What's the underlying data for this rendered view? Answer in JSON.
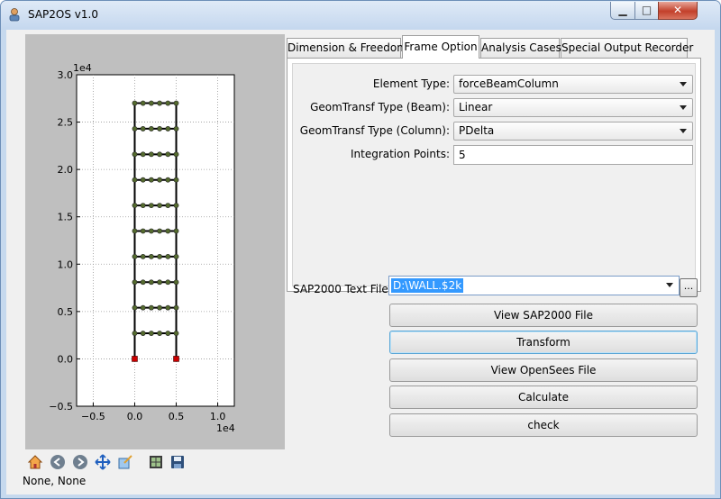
{
  "window": {
    "title": "SAP2OS v1.0",
    "min_glyph": "▁",
    "max_glyph": "□",
    "close_glyph": "✕"
  },
  "tabs": [
    {
      "label": "Dimension & Freedom",
      "active": false
    },
    {
      "label": "Frame Option",
      "active": true
    },
    {
      "label": "Analysis Cases",
      "active": false
    },
    {
      "label": "Special Output Recorder",
      "active": false
    }
  ],
  "frame_option": {
    "element_type": {
      "label": "Element Type:",
      "value": "forceBeamColumn"
    },
    "geom_beam": {
      "label": "GeomTransf Type (Beam):",
      "value": "Linear"
    },
    "geom_column": {
      "label": "GeomTransf Type (Column):",
      "value": "PDelta"
    },
    "integration": {
      "label": "Integration Points:",
      "value": "5"
    }
  },
  "sap_file": {
    "label": "SAP2000 Text File:",
    "value": "D:\\WALL.$2k",
    "browse_label": "..."
  },
  "actions": {
    "view_sap": "View SAP2000 File",
    "transform": "Transform",
    "view_opensees": "View OpenSees File",
    "calculate": "Calculate",
    "check": "check"
  },
  "status": {
    "text": "None, None"
  },
  "toolbar_icons": [
    "home-icon",
    "back-icon",
    "forward-icon",
    "pan-icon",
    "zoom-icon",
    "subplot-config-icon",
    "save-icon"
  ],
  "chart_data": {
    "type": "scatter",
    "description_free": true,
    "x_scale_label": "1e4",
    "y_scale_label": "1e4",
    "xlim": [
      -0.7,
      1.2
    ],
    "ylim": [
      -0.5,
      3.0
    ],
    "xticks": [
      -0.5,
      0.0,
      0.5,
      1.0
    ],
    "xtick_labels": [
      "−0.5",
      "0.0",
      "0.5",
      "1.0"
    ],
    "yticks": [
      -0.5,
      0.0,
      0.5,
      1.0,
      1.5,
      2.0,
      2.5,
      3.0
    ],
    "ytick_labels": [
      "−0.5",
      "0.0",
      "0.5",
      "1.0",
      "1.5",
      "2.0",
      "2.5",
      "3.0"
    ],
    "grid": true,
    "columns_x": [
      0.0,
      0.5
    ],
    "inner_x": [
      0.1,
      0.2,
      0.3,
      0.4
    ],
    "floor_y": [
      0.0,
      0.27,
      0.54,
      0.81,
      1.08,
      1.35,
      1.62,
      1.89,
      2.16,
      2.43,
      2.7
    ],
    "support_y": 0.0,
    "colors": {
      "line": "#000000",
      "node": "#556b2f",
      "support": "#cc0000",
      "frame": "#000000"
    }
  }
}
